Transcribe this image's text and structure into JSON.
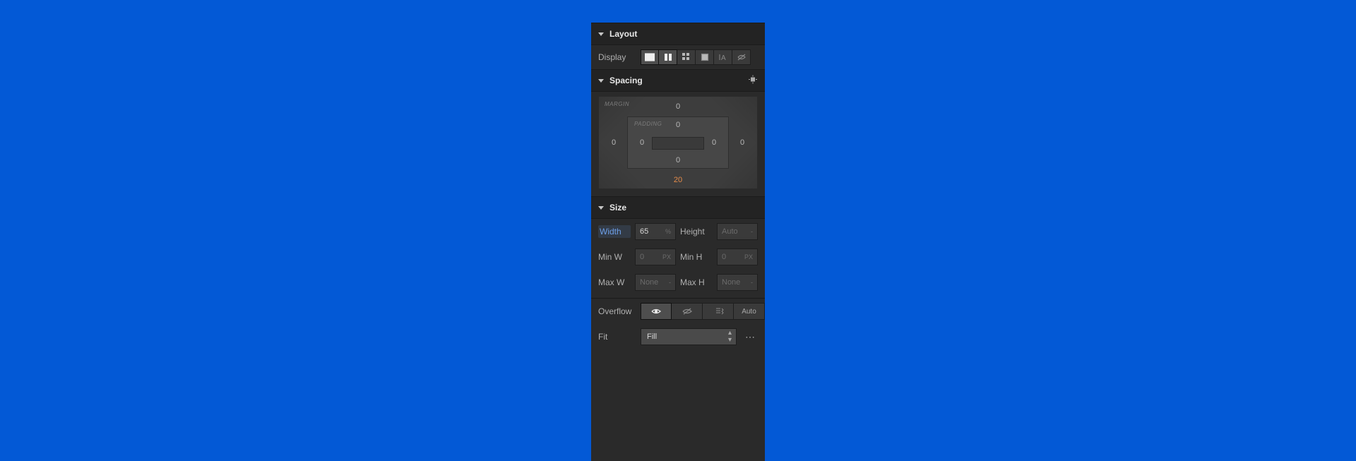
{
  "layout": {
    "title": "Layout",
    "display_label": "Display"
  },
  "spacing": {
    "title": "Spacing",
    "margin_label": "MARGIN",
    "padding_label": "PADDING",
    "margin": {
      "top": "0",
      "right": "0",
      "bottom": "20",
      "left": "0"
    },
    "padding": {
      "top": "0",
      "right": "0",
      "bottom": "0",
      "left": "0"
    }
  },
  "size": {
    "title": "Size",
    "width_label": "Width",
    "width_value": "65",
    "width_unit": "%",
    "height_label": "Height",
    "height_placeholder": "Auto",
    "height_unit": "-",
    "minw_label": "Min W",
    "minw_placeholder": "0",
    "minw_unit": "PX",
    "minh_label": "Min H",
    "minh_placeholder": "0",
    "minh_unit": "PX",
    "maxw_label": "Max W",
    "maxw_placeholder": "None",
    "maxw_unit": "-",
    "maxh_label": "Max H",
    "maxh_placeholder": "None",
    "maxh_unit": "-",
    "overflow_label": "Overflow",
    "overflow_auto": "Auto",
    "fit_label": "Fit",
    "fit_value": "Fill"
  }
}
